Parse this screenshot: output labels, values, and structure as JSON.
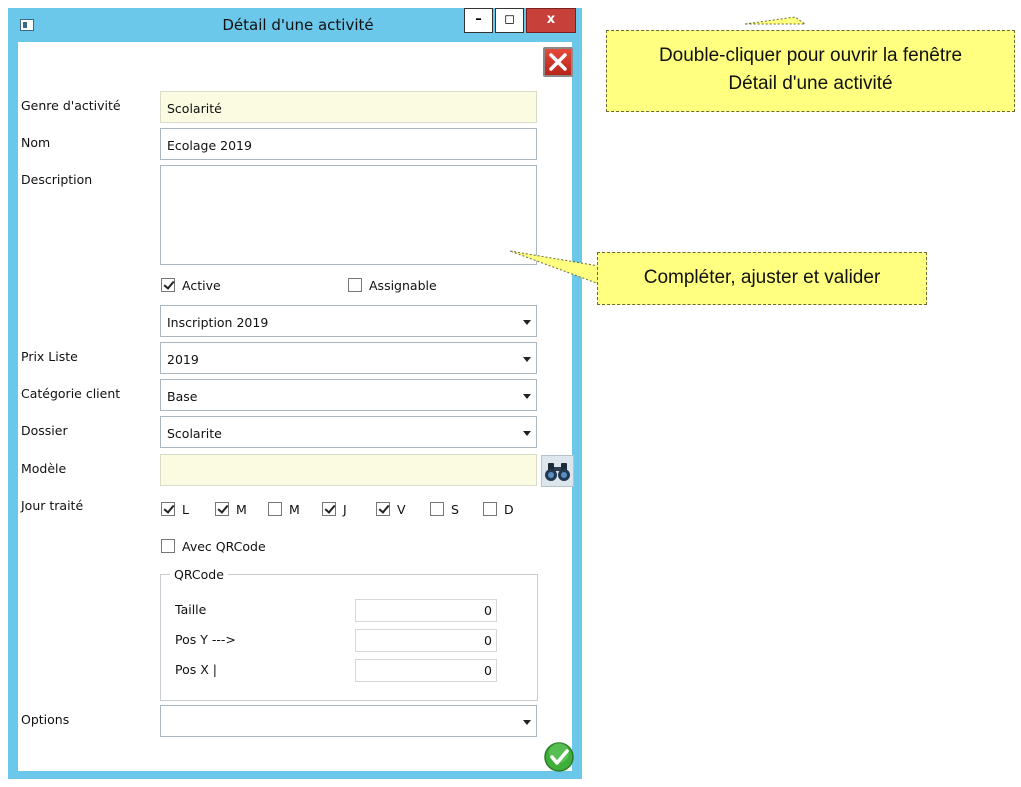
{
  "window": {
    "title": "Détail d'une activité",
    "min_label": "–",
    "max_label": "◻",
    "close_label": "x"
  },
  "form": {
    "genre_label": "Genre d'activité",
    "genre_value": "Scolarité",
    "nom_label": "Nom",
    "nom_value": "Ecolage 2019",
    "description_label": "Description",
    "description_value": "",
    "active_label": "Active",
    "active_checked": true,
    "assignable_label": "Assignable",
    "assignable_checked": false,
    "inscription_value": "Inscription 2019",
    "prix_label": "Prix Liste",
    "prix_value": "2019",
    "categorie_label": "Catégorie client",
    "categorie_value": "Base",
    "dossier_label": "Dossier",
    "dossier_value": "Scolarite",
    "modele_label": "Modèle",
    "modele_value": "",
    "jour_label": "Jour traité",
    "jours": [
      {
        "label": "L",
        "checked": true
      },
      {
        "label": "M",
        "checked": true
      },
      {
        "label": "M",
        "checked": false
      },
      {
        "label": "J",
        "checked": true
      },
      {
        "label": "V",
        "checked": true
      },
      {
        "label": "S",
        "checked": false
      },
      {
        "label": "D",
        "checked": false
      }
    ],
    "qrcode_check_label": "Avec QRCode",
    "qrcode_checked": false,
    "qrcode_group_title": "QRCode",
    "taille_label": "Taille",
    "taille_value": "0",
    "posy_label": "Pos Y --->",
    "posy_value": "0",
    "posx_label": "Pos X |",
    "posx_value": "0",
    "options_label": "Options",
    "options_value": ""
  },
  "callouts": {
    "top_line1": "Double-cliquer pour ouvrir la fenêtre",
    "top_line2": "Détail d'une activité",
    "middle": "Compléter, ajuster et valider"
  },
  "colors": {
    "titlebar": "#6cc8ea",
    "callout_bg": "#ffff80",
    "readonly_bg": "#fbfbe2",
    "close_red": "#c7403a",
    "ok_green": "#3fae3a"
  }
}
